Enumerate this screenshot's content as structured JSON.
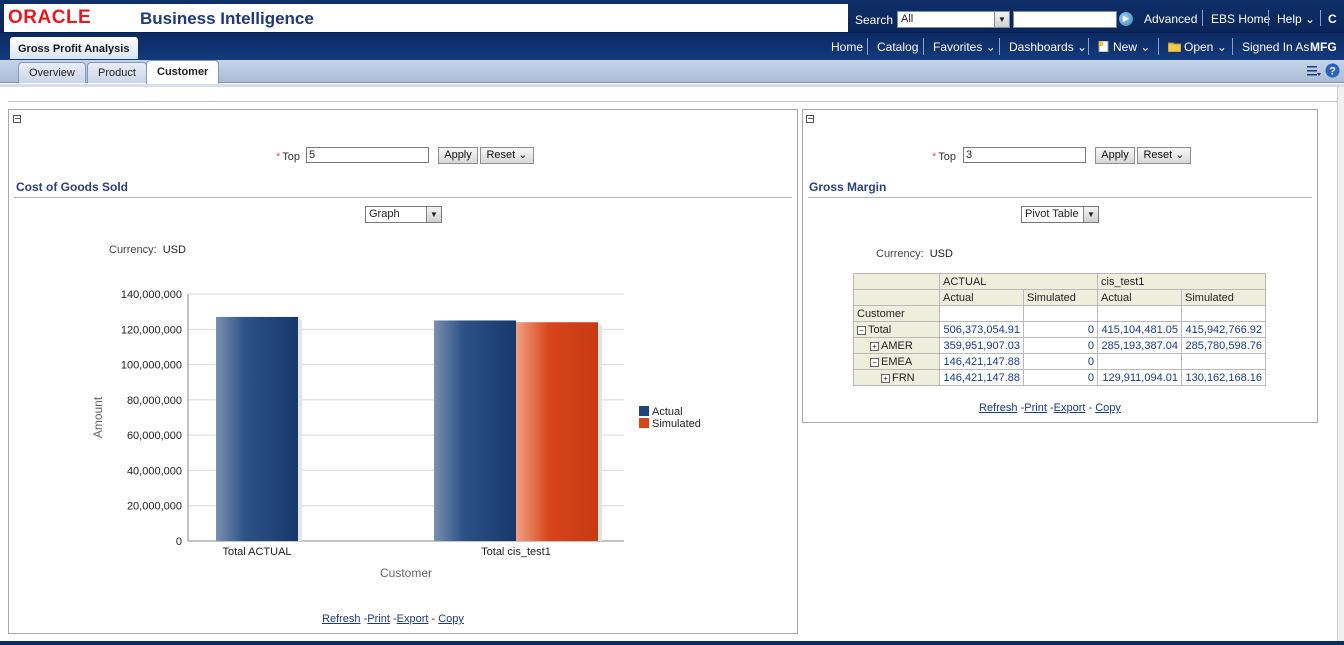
{
  "header": {
    "logo": "ORACLE",
    "app_title": "Business Intelligence",
    "search_label": "Search",
    "search_scope": "All",
    "search_value": "",
    "advanced": "Advanced",
    "ebs_home": "EBS Home",
    "help": "Help ⌄",
    "dashboard_title": "Gross Profit Analysis",
    "nav": {
      "home": "Home",
      "catalog": "Catalog",
      "favorites": "Favorites ⌄",
      "dashboards": "Dashboards ⌄",
      "new": "New ⌄",
      "open": "Open ⌄",
      "signed_in_as": "Signed In As",
      "user": "MFG"
    }
  },
  "tabs": [
    {
      "label": "Overview"
    },
    {
      "label": "Product"
    },
    {
      "label": "Customer"
    }
  ],
  "left_panel": {
    "prompt_label": "Top",
    "prompt_value": "5",
    "apply": "Apply",
    "reset": "Reset ⌄",
    "title": "Cost of Goods Sold",
    "view": "Graph",
    "currency_label": "Currency:",
    "currency_value": "USD",
    "links": {
      "refresh": "Refresh",
      "print": "Print",
      "export": "Export",
      "copy": "Copy"
    }
  },
  "right_panel": {
    "prompt_label": "Top",
    "prompt_value": "3",
    "apply": "Apply",
    "reset": "Reset ⌄",
    "title": "Gross Margin",
    "view": "Pivot Table",
    "currency_label": "Currency:",
    "currency_value": "USD",
    "links": {
      "refresh": "Refresh",
      "print": "Print",
      "export": "Export",
      "copy": "Copy"
    },
    "pivot": {
      "col_groups": [
        "ACTUAL",
        "cis_test1"
      ],
      "col_measures": [
        "Actual",
        "Simulated",
        "Actual",
        "Simulated"
      ],
      "row_header": "Customer",
      "rows": [
        {
          "label": "Total",
          "toggle": "−",
          "cells": [
            "506,373,054.91",
            "0",
            "415,104,481.05",
            "415,942,766.92"
          ]
        },
        {
          "label": "AMER",
          "toggle": "+",
          "cells": [
            "359,951,907.03",
            "0",
            "285,193,387.04",
            "285,780,598.76"
          ]
        },
        {
          "label": "EMEA",
          "toggle": "−",
          "cells": [
            "146,421,147.88",
            "0",
            "",
            ""
          ]
        },
        {
          "label": "FRN",
          "toggle": "+",
          "cells": [
            "146,421,147.88",
            "0",
            "129,911,094.01",
            "130,162,168.16"
          ]
        }
      ]
    }
  },
  "colors": {
    "actual": "#1f4478",
    "simulated": "#d8441c",
    "header_bg": "#0b2a62"
  },
  "chart_data": {
    "type": "bar",
    "categories": [
      "Total ACTUAL",
      "Total cis_test1"
    ],
    "series": [
      {
        "name": "Actual",
        "values": [
          127000000,
          125000000
        ]
      },
      {
        "name": "Simulated",
        "values": [
          0,
          124000000
        ]
      }
    ],
    "xlabel": "Customer",
    "ylabel": "Amount",
    "ylim": [
      0,
      140000000
    ],
    "yticks": [
      "0",
      "20,000,000",
      "40,000,000",
      "60,000,000",
      "80,000,000",
      "100,000,000",
      "120,000,000",
      "140,000,000"
    ],
    "grid": true,
    "legend": "right"
  }
}
